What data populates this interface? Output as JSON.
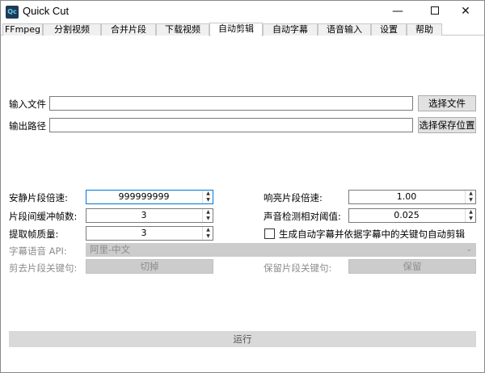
{
  "window": {
    "app_icon": "Qc",
    "title": "Quick Cut",
    "minimize_glyph": "—",
    "close_glyph": "✕"
  },
  "tabs": [
    {
      "label": "FFmpeg"
    },
    {
      "label": "分割视频"
    },
    {
      "label": "合并片段"
    },
    {
      "label": "下载视频"
    },
    {
      "label": "自动剪辑"
    },
    {
      "label": "自动字幕"
    },
    {
      "label": "语音输入"
    },
    {
      "label": "设置"
    },
    {
      "label": "帮助"
    }
  ],
  "active_tab": "自动剪辑",
  "input_file": {
    "label": "输入文件",
    "value": "",
    "button": "选择文件"
  },
  "output_path": {
    "label": "输出路径",
    "value": "",
    "button": "选择保存位置"
  },
  "params": {
    "silent_speed": {
      "label": "安静片段倍速:",
      "value": "999999999"
    },
    "sounded_speed": {
      "label": "响亮片段倍速:",
      "value": "1.00"
    },
    "buffer_frames": {
      "label": "片段间缓冲帧数:",
      "value": "3"
    },
    "threshold": {
      "label": "声音检测相对阈值:",
      "value": "0.025"
    },
    "frame_quality": {
      "label": "提取帧质量:",
      "value": "3"
    },
    "auto_subtitle_checkbox": {
      "label": "生成自动字幕并依据字幕中的关键句自动剪辑",
      "checked": false
    }
  },
  "subtitle_api": {
    "label": "字幕语音 API:",
    "value": "阿里-中文"
  },
  "cut_keyword": {
    "label": "剪去片段关键句:",
    "value": "切掉"
  },
  "keep_keyword": {
    "label": "保留片段关键句:",
    "value": "保留"
  },
  "run_button": "运行",
  "icons": {
    "spin_up": "▲",
    "spin_down": "▼",
    "combo_chevron": "⌄"
  }
}
